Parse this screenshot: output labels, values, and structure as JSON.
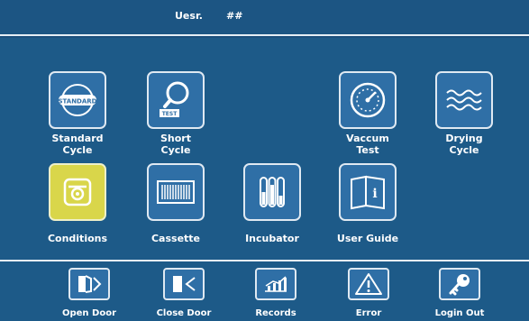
{
  "header": {
    "user_label": "Uesr.",
    "user_value": "##"
  },
  "main": {
    "tiles": [
      {
        "icon": "standard-badge-icon",
        "label": "Standard\nCycle"
      },
      {
        "icon": "magnifier-test-icon",
        "label": "Short\nCycle"
      },
      {
        "icon": "gauge-icon",
        "label": "Vaccum\nTest"
      },
      {
        "icon": "waves-icon",
        "label": "Drying\nCycle"
      },
      {
        "icon": "conditions-icon",
        "label": "Conditions"
      },
      {
        "icon": "cassette-icon",
        "label": "Cassette"
      },
      {
        "icon": "incubator-icon",
        "label": "Incubator"
      },
      {
        "icon": "book-info-icon",
        "label": "User Guide"
      }
    ]
  },
  "footer": {
    "buttons": [
      {
        "icon": "open-door-icon",
        "label": "Open Door"
      },
      {
        "icon": "close-door-icon",
        "label": "Close Door"
      },
      {
        "icon": "chart-icon",
        "label": "Records"
      },
      {
        "icon": "warning-icon",
        "label": "Error"
      },
      {
        "icon": "key-icon",
        "label": "Login Out"
      }
    ]
  },
  "colors": {
    "background": "#1d5a88",
    "tile": "#2f6fa6",
    "highlight": "#d9d64a",
    "border": "#dfe9f2"
  }
}
